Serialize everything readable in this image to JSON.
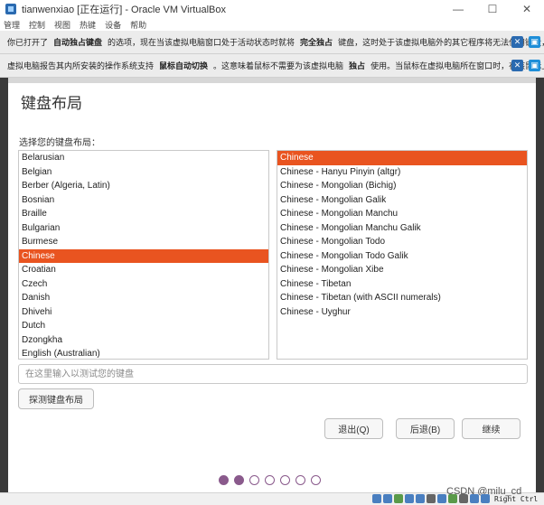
{
  "window": {
    "title": "tianwenxiao [正在运行] - Oracle VM VirtualBox",
    "minimize": "—",
    "maximize": "☐",
    "close": "✕"
  },
  "menu": [
    "管理",
    "控制",
    "视图",
    "热键",
    "设备",
    "帮助"
  ],
  "notice1": {
    "pre": "你已打开了",
    "bold1": "自动独占键盘",
    "mid": "的选项，现在当该虚拟电脑窗口处于活动状态时就将",
    "bold2": "完全独占",
    "post": "键盘，这时处于该虚拟电脑外的其它程序将无法使用键盘，当键盘"
  },
  "notice2": {
    "pre": "虚拟电脑报告其内所安装的操作系统支持",
    "bold1": "鼠标自动切换",
    "mid": "。这意味着鼠标不需要为该虚拟电脑",
    "bold2": "独占",
    "post": "使用。当鼠标在虚拟电脑所在窗口时，在该鼠标上的所有"
  },
  "installer": {
    "title": "键盘布局",
    "prompt": "选择您的键盘布局：",
    "layouts": [
      "Belarusian",
      "Belgian",
      "Berber (Algeria, Latin)",
      "Bosnian",
      "Braille",
      "Bulgarian",
      "Burmese",
      "Chinese",
      "Croatian",
      "Czech",
      "Danish",
      "Dhivehi",
      "Dutch",
      "Dzongkha",
      "English (Australian)"
    ],
    "selected_layout": "Chinese",
    "variants": [
      "Chinese",
      "Chinese - Hanyu Pinyin (altgr)",
      "Chinese - Mongolian (Bichig)",
      "Chinese - Mongolian Galik",
      "Chinese - Mongolian Manchu",
      "Chinese - Mongolian Manchu Galik",
      "Chinese - Mongolian Todo",
      "Chinese - Mongolian Todo Galik",
      "Chinese - Mongolian Xibe",
      "Chinese - Tibetan",
      "Chinese - Tibetan (with ASCII numerals)",
      "Chinese - Uyghur"
    ],
    "selected_variant": "Chinese",
    "test_placeholder": "在这里输入以测试您的键盘",
    "detect_button": "探测键盘布局",
    "quit_button": "退出(Q)",
    "back_button": "后退(B)",
    "continue_button": "继续",
    "steps_total": 7,
    "steps_done": 2
  },
  "statusbar": {
    "watermark": "CSDN @milu_cd",
    "host_key": "Right Ctrl"
  },
  "colors": {
    "accent": "#e95420",
    "progress": "#8a5a8c"
  }
}
